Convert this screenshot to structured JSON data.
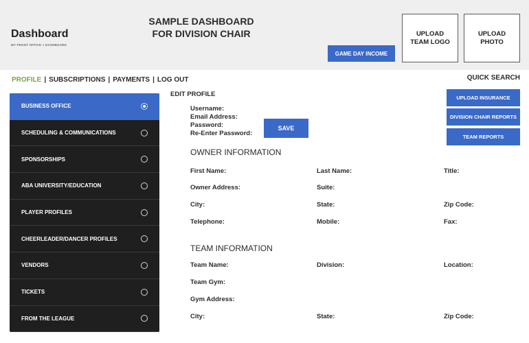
{
  "header": {
    "title": "Dashboard",
    "breadcrumb": "MY FRONT OFFICE > DASHBOARD",
    "sample_title_line1": "SAMPLE DASHBOARD",
    "sample_title_line2": "FOR DIVISION CHAIR",
    "game_day_income": "GAME DAY INCOME",
    "upload_logo_line1": "UPLOAD",
    "upload_logo_line2": "TEAM LOGO",
    "upload_photo_line1": "UPLOAD",
    "upload_photo_line2": "PHOTO"
  },
  "nav": {
    "profile": "PROFILE",
    "subscriptions": "SUBSCRIPTIONS",
    "payments": "PAYMENTS",
    "logout": "LOG OUT",
    "separator": "|",
    "quick_search": "QUICK SEARCH"
  },
  "sidebar": {
    "items": [
      {
        "label": "BUSINESS OFFICE",
        "active": true
      },
      {
        "label": "SCHEDULING & COMMUNICATIONS",
        "active": false
      },
      {
        "label": "SPONSORSHIPS",
        "active": false
      },
      {
        "label": "ABA UNIVERSITY/EDUCATION",
        "active": false
      },
      {
        "label": "PLAYER PROFILES",
        "active": false
      },
      {
        "label": "CHEERLEADER/DANCER PROFILES",
        "active": false
      },
      {
        "label": "VENDORS",
        "active": false
      },
      {
        "label": "TICKETS",
        "active": false
      },
      {
        "label": "FROM THE LEAGUE",
        "active": false
      }
    ]
  },
  "profile": {
    "edit_title": "EDIT PROFILE",
    "username": "Username:",
    "email": "Email Address:",
    "password": "Password:",
    "reenter": "Re-Enter Password:",
    "save": "SAVE"
  },
  "actions": {
    "upload_insurance": "UPLOAD INSURANCE",
    "division_reports": "DIVISION CHAIR REPORTS",
    "team_reports": "TEAM REPORTS"
  },
  "owner": {
    "title": "OWNER INFORMATION",
    "first_name": "First Name:",
    "last_name": "Last Name:",
    "title_field": "Title:",
    "address": "Owner Address:",
    "suite": "Suite:",
    "city": "City:",
    "state": "State:",
    "zip": "Zip Code:",
    "telephone": "Telephone:",
    "mobile": "Mobile:",
    "fax": "Fax:"
  },
  "team": {
    "title": "TEAM INFORMATION",
    "team_name": "Team Name:",
    "division": "Division:",
    "location": "Location:",
    "gym": "Team Gym:",
    "gym_address": "Gym Address:",
    "city": "City:",
    "state": "State:",
    "zip": "Zip Code:"
  },
  "colors": {
    "accent_blue": "#3a69c7",
    "nav_active_green": "#7aa63d",
    "sidebar_dark": "#1f1f1f",
    "header_gray": "#efefef"
  }
}
